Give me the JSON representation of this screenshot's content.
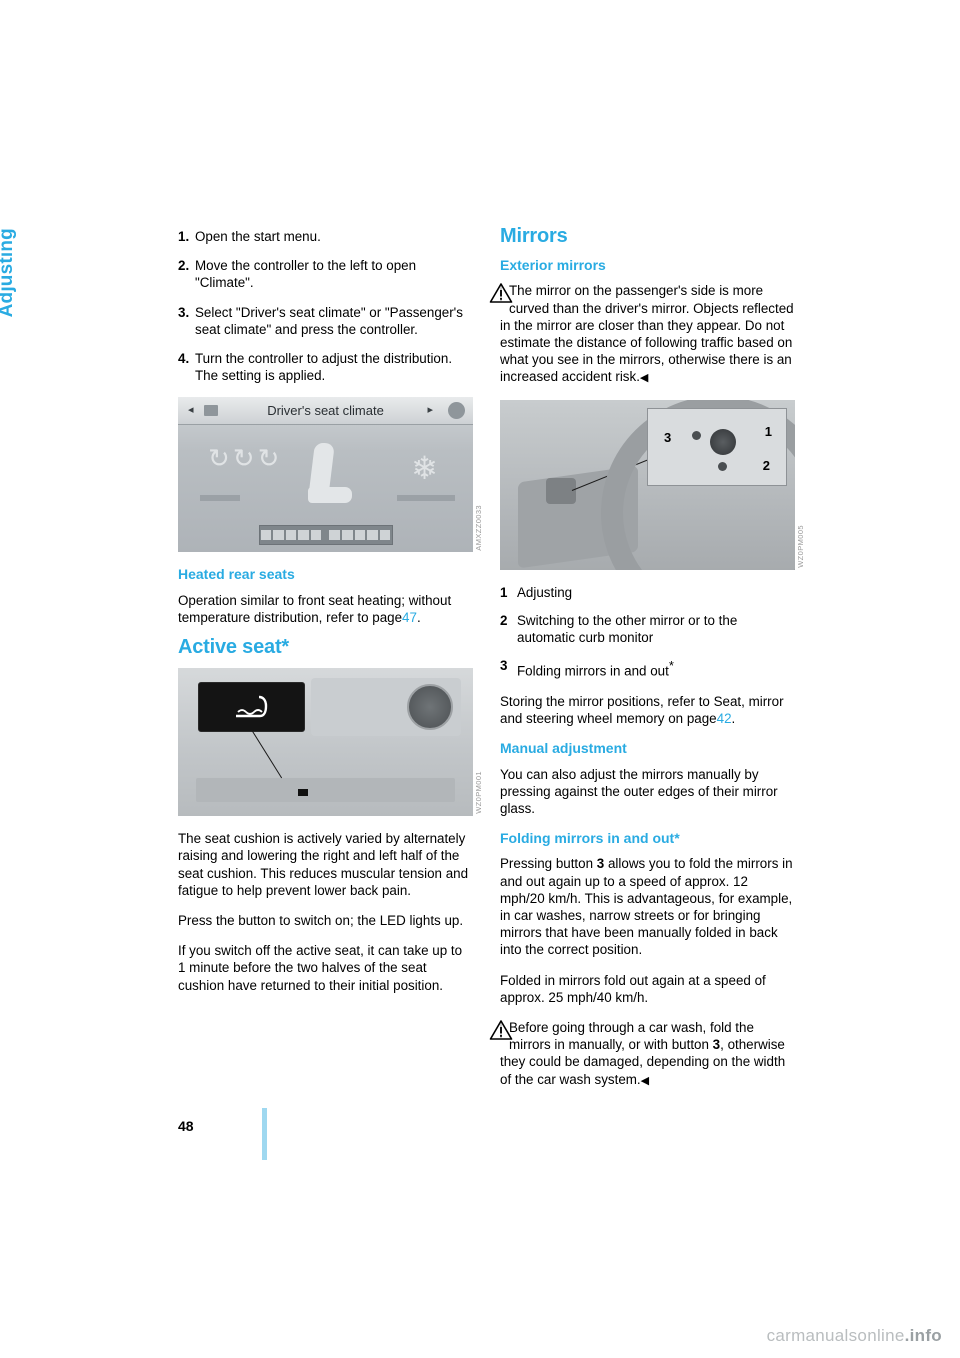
{
  "sidebar": {
    "chapter": "Adjusting"
  },
  "left": {
    "steps": [
      {
        "num": "1.",
        "text": "Open the start menu."
      },
      {
        "num": "2.",
        "text": "Move the controller to the left to open \"Climate\"."
      },
      {
        "num": "3.",
        "text": "Select \"Driver's seat climate\" or \"Passenger's seat climate\" and press the controller."
      },
      {
        "num": "4.",
        "text": "Turn the controller to adjust the distribution.",
        "text2": "The setting is applied."
      }
    ],
    "screen_image": {
      "title": "Driver's seat climate",
      "arrow_left": "◂",
      "arrow_right": "▸",
      "code": "AMXZZ0033"
    },
    "heated_rear_seats": {
      "heading": "Heated rear seats",
      "body_a": "Operation similar to front seat heating; without temperature distribution, refer to page",
      "page_ref": "47",
      "body_b": "."
    },
    "active_seat": {
      "heading": "Active seat*",
      "photo_code": "WZ0PM001",
      "p1": "The seat cushion is actively varied by alternately raising and lowering the right and left half of the seat cushion. This reduces muscular tension and fatigue to help prevent lower back pain.",
      "p2": "Press the button to switch on; the LED lights up.",
      "p3": "If you switch off the active seat, it can take up to 1 minute before the two halves of the seat cushion have returned to their initial position."
    }
  },
  "right": {
    "mirrors_heading": "Mirrors",
    "exterior_heading": "Exterior mirrors",
    "warning": {
      "icon": "warning-triangle-icon",
      "text": "The mirror on the passenger's side is more curved than the driver's mirror. Objects reflected in the mirror are closer than they appear. Do not estimate the distance of following traffic based on what you see in the mirrors, otherwise there is an increased accident risk.",
      "end_mark": "◀"
    },
    "photo_code": "WZ0PM005",
    "legend": [
      {
        "num": "1",
        "text": "Adjusting"
      },
      {
        "num": "2",
        "text": "Switching to the other mirror or to the automatic curb monitor"
      },
      {
        "num": "3",
        "text": "Folding mirrors in and out",
        "star": "*"
      }
    ],
    "storing": {
      "text_a": "Storing the mirror positions, refer to Seat, mirror and steering wheel memory on page",
      "page_ref": "42",
      "text_b": "."
    },
    "manual_heading": "Manual adjustment",
    "manual_text": "You can also adjust the mirrors manually by pressing against the outer edges of their mirror glass.",
    "folding_heading": "Folding mirrors in and out*",
    "folding_p1_a": "Pressing button",
    "folding_p1_bold": "3",
    "folding_p1_b": "allows you to fold the mirrors in and out again up to a speed of approx. 12 mph/20 km/h. This is advantageous, for example, in car washes, narrow streets or for bringing mirrors that have been manually folded in back into the correct position.",
    "folding_p2": "Folded in mirrors fold out again at a speed of approx. 25 mph/40 km/h.",
    "notice": {
      "icon": "warning-triangle-icon",
      "text_a": "Before going through a car wash, fold the mirrors in manually, or with button",
      "bold": "3",
      "text_b": ", otherwise they could be damaged, depending on the width of the car wash system.",
      "end_mark": "◀"
    }
  },
  "footer": {
    "page_number": "48",
    "watermark_plain": "carmanualsonline",
    "watermark_suffix": ".info"
  }
}
